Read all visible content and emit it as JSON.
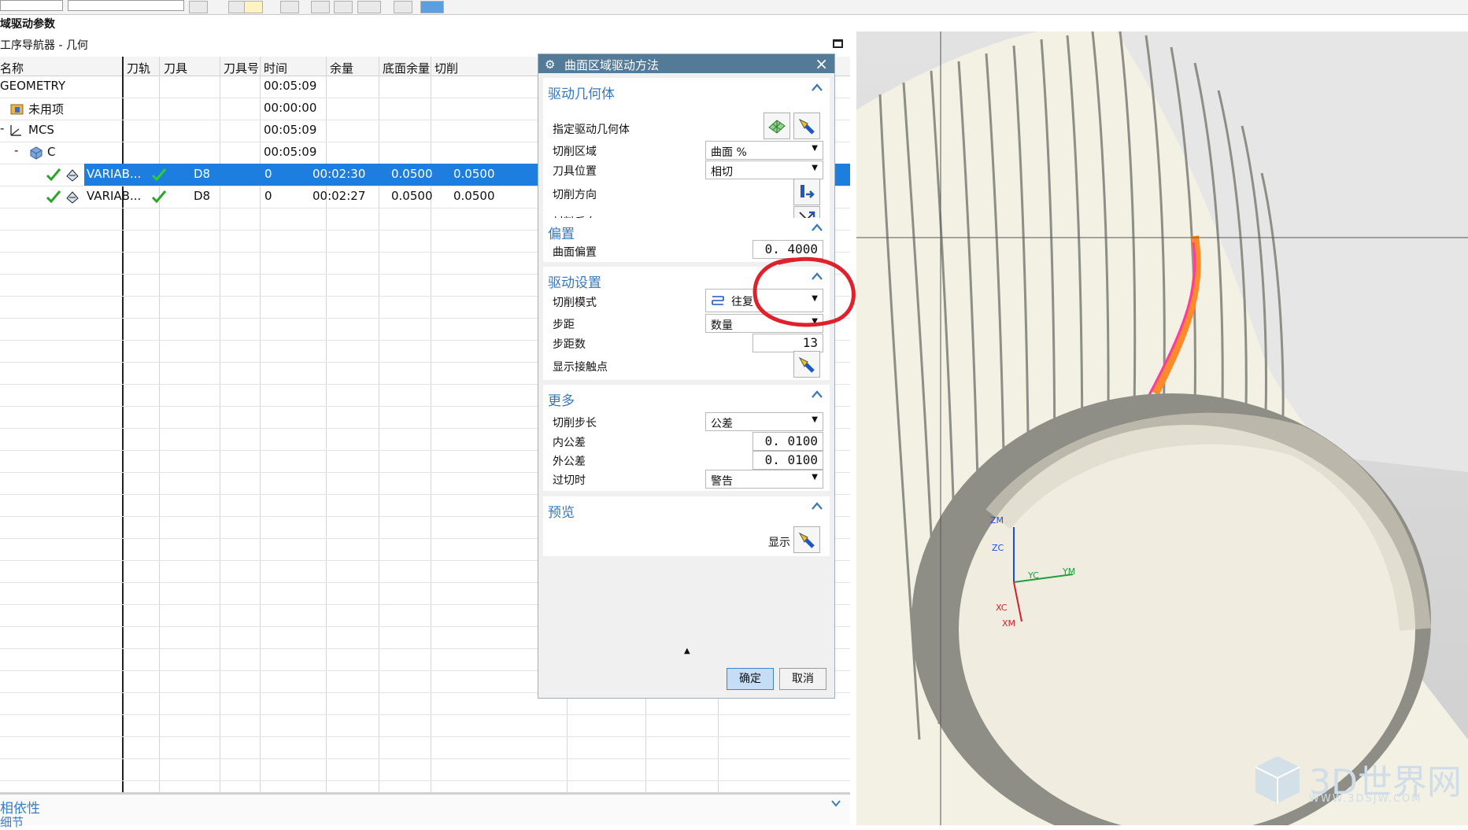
{
  "window": {
    "title": "域驱动参数",
    "navigator_title": "工序导航器 - 几何"
  },
  "grid": {
    "columns": [
      "名称",
      "刀轨",
      "刀具",
      "刀具号",
      "时间",
      "余量",
      "底面余量",
      "切削"
    ],
    "rows": [
      {
        "name": "GEOMETRY",
        "toolpath": "",
        "tool": "",
        "tool_no": "",
        "time": "00:05:09",
        "stock": "",
        "floor": ""
      },
      {
        "name": "未用项",
        "toolpath": "",
        "tool": "",
        "tool_no": "",
        "time": "00:00:00",
        "stock": "",
        "floor": ""
      },
      {
        "name": "MCS",
        "toolpath": "",
        "tool": "",
        "tool_no": "",
        "time": "00:05:09",
        "stock": "",
        "floor": ""
      },
      {
        "name": "C",
        "toolpath": "",
        "tool": "",
        "tool_no": "",
        "time": "00:05:09",
        "stock": "",
        "floor": ""
      },
      {
        "name": "VARIAB...",
        "toolpath": "✓",
        "tool": "D8",
        "tool_no": "0",
        "time": "00:02:30",
        "stock": "0.0500",
        "floor": "0.0500"
      },
      {
        "name": "VARIAB...",
        "toolpath": "✓",
        "tool": "D8",
        "tool_no": "0",
        "time": "00:02:27",
        "stock": "0.0500",
        "floor": "0.0500"
      }
    ],
    "selected_row": 4
  },
  "bottom": {
    "dependencies": "相依性",
    "details": "细节"
  },
  "dialog": {
    "title": "曲面区域驱动方法",
    "close": "×",
    "sections": {
      "drive_geometry": {
        "title": "驱动几何体",
        "specify_label": "指定驱动几何体",
        "cut_area_label": "切削区域",
        "cut_area_value": "曲面 %",
        "tool_position_label": "刀具位置",
        "tool_position_value": "相切",
        "cut_direction_label": "切削方向",
        "material_reverse_label": "材料反向"
      },
      "offset": {
        "title": "偏置",
        "surface_offset_label": "曲面偏置",
        "surface_offset_value": "0. 4000"
      },
      "drive_settings": {
        "title": "驱动设置",
        "cut_pattern_label": "切削模式",
        "cut_pattern_value": "往复",
        "stepover_label": "步距",
        "stepover_value": "数量",
        "stepover_count_label": "步距数",
        "stepover_count_value": "13",
        "contact_points_label": "显示接触点"
      },
      "more": {
        "title": "更多",
        "cut_step_label": "切削步长",
        "cut_step_value": "公差",
        "intol_label": "内公差",
        "intol_value": "0. 0100",
        "outtol_label": "外公差",
        "outtol_value": "0. 0100",
        "overcut_label": "过切时",
        "overcut_value": "警告"
      },
      "preview": {
        "title": "预览",
        "display_label": "显示"
      }
    },
    "ok": "确定",
    "cancel": "取消"
  },
  "viewport": {
    "axes": [
      "ZM",
      "ZC",
      "YC",
      "YM",
      "XC",
      "XM"
    ],
    "watermark": "3D世界网",
    "watermark_url": "WWW.3DSJW.COM"
  },
  "colors": {
    "selection": "#1d7ee0",
    "dialog_header": "#537b98",
    "section_title": "#3778b8",
    "annotation": "#e0202a",
    "part_body": "#f3f1e4",
    "toolpath": "#ff8a2a"
  }
}
